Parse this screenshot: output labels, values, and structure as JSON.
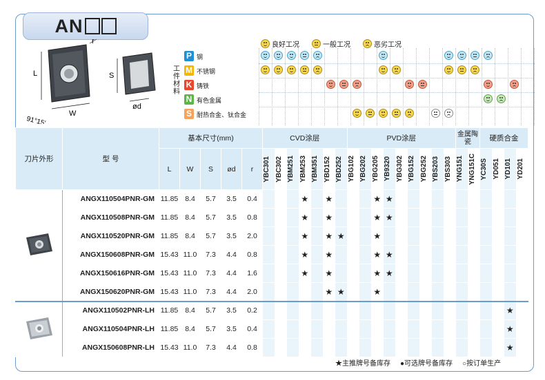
{
  "title": "AN",
  "title_boxes": "□□",
  "drawing": {
    "l": "L",
    "w": "W",
    "s": "S",
    "d": "ød",
    "r": "r",
    "angle": "91°15'"
  },
  "condition_legend": {
    "good": "良好工况",
    "normal": "一般工况",
    "bad": "恶劣工况"
  },
  "workpiece_label": "工件材料",
  "materials": [
    {
      "tag": "P",
      "name": "钢",
      "color": "#1f8fd6"
    },
    {
      "tag": "M",
      "name": "不锈钢",
      "color": "#f2b705"
    },
    {
      "tag": "K",
      "name": "铸铁",
      "color": "#e8462d"
    },
    {
      "tag": "N",
      "name": "有色金属",
      "color": "#5fb648"
    },
    {
      "tag": "S",
      "name": "耐热合金、钛合金",
      "color": "#f5a25a"
    }
  ],
  "headers": {
    "shape": "刀片外形",
    "model": "型 号",
    "dims": "基本尺寸(mm)",
    "dim_cols": [
      "L",
      "W",
      "S",
      "ød",
      "r"
    ],
    "cvd": "CVD涂层",
    "pvd": "PVD涂层",
    "cermet": "金属陶瓷",
    "carbide": "硬质合金",
    "grades": [
      "YBC301",
      "YBC302",
      "YBM251",
      "YBM253",
      "YBM351",
      "YBD152",
      "YBD252",
      "YBG102",
      "YBG202",
      "YBG205",
      "YB9320",
      "YBG302",
      "YBG152",
      "YBG252",
      "YBS203",
      "YBS303",
      "YNG151",
      "YNG151C",
      "YC30S",
      "YD051",
      "YD101",
      "YD201"
    ]
  },
  "rows": [
    {
      "model": "ANGX110504PNR-GM",
      "dims": [
        "11.85",
        "8.4",
        "5.7",
        "3.5",
        "0.4"
      ],
      "stars": [
        3,
        5,
        9,
        10
      ]
    },
    {
      "model": "ANGX110508PNR-GM",
      "dims": [
        "11.85",
        "8.4",
        "5.7",
        "3.5",
        "0.8"
      ],
      "stars": [
        3,
        5,
        9,
        10
      ]
    },
    {
      "model": "ANGX110520PNR-GM",
      "dims": [
        "11.85",
        "8.4",
        "5.7",
        "3.5",
        "2.0"
      ],
      "stars": [
        3,
        5,
        6,
        9
      ]
    },
    {
      "model": "ANGX150608PNR-GM",
      "dims": [
        "15.43",
        "11.0",
        "7.3",
        "4.4",
        "0.8"
      ],
      "stars": [
        3,
        5,
        9,
        10
      ]
    },
    {
      "model": "ANGX150616PNR-GM",
      "dims": [
        "15.43",
        "11.0",
        "7.3",
        "4.4",
        "1.6"
      ],
      "stars": [
        3,
        5,
        9,
        10
      ]
    },
    {
      "model": "ANGX150620PNR-GM",
      "dims": [
        "15.43",
        "11.0",
        "7.3",
        "4.4",
        "2.0"
      ],
      "stars": [
        5,
        6,
        9
      ]
    },
    {
      "model": "ANGX110502PNR-LH",
      "dims": [
        "11.85",
        "8.4",
        "5.7",
        "3.5",
        "0.2"
      ],
      "stars": [
        20
      ]
    },
    {
      "model": "ANGX110504PNR-LH",
      "dims": [
        "11.85",
        "8.4",
        "5.7",
        "3.5",
        "0.4"
      ],
      "stars": [
        20
      ]
    },
    {
      "model": "ANGX150608PNR-LH",
      "dims": [
        "15.43",
        "11.0",
        "7.3",
        "4.4",
        "0.8"
      ],
      "stars": [
        20
      ]
    }
  ],
  "star_glyph": "★",
  "footer": {
    "main": "★主推牌号备库存",
    "optional": "●可选牌号备库存",
    "order": "○按订单生产"
  }
}
